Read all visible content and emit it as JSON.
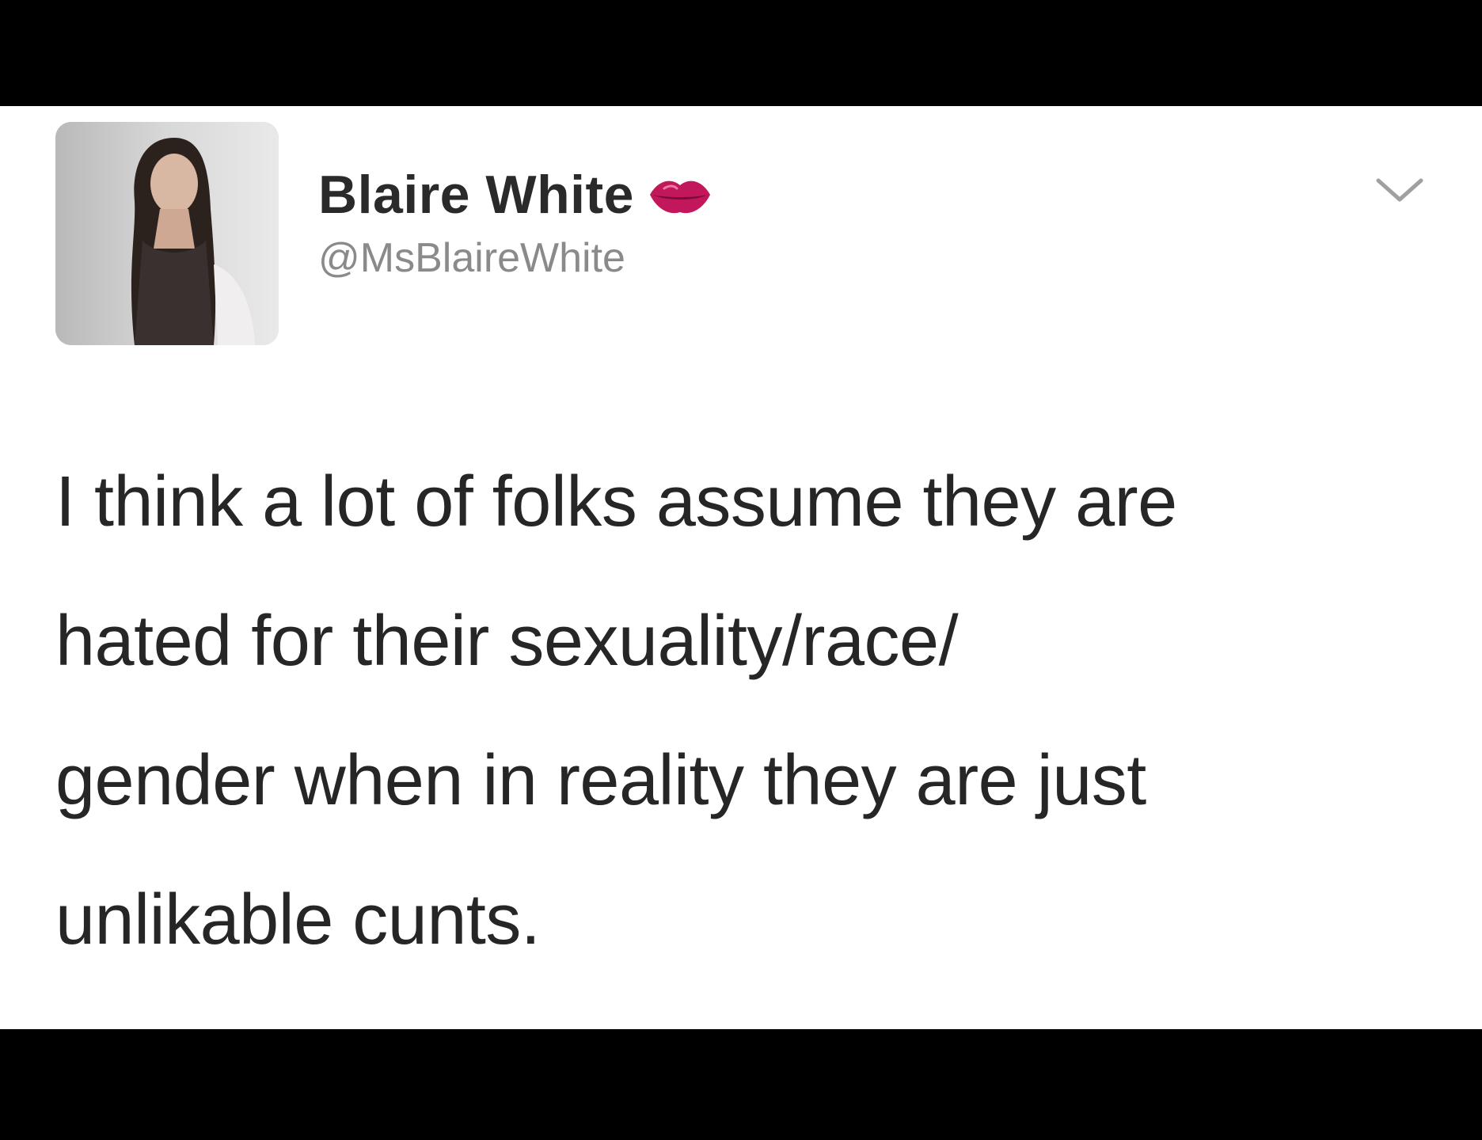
{
  "tweet": {
    "author": {
      "display_name": "Blaire White",
      "handle": "@MsBlaireWhite",
      "verified_badge_icon": "lips-kiss-icon",
      "avatar_icon": "profile-photo"
    },
    "menu_icon": "chevron-down-icon",
    "text_lines": [
      "I think a lot of folks assume they are",
      "hated for their sexuality/race/",
      "gender when in reality they are just",
      "unlikable cunts."
    ]
  },
  "colors": {
    "background": "#ffffff",
    "letterbox": "#000000",
    "name_text": "#2a2a2a",
    "handle_text": "#8a8a8a",
    "body_text": "#262626",
    "badge": "#c2185b",
    "chevron": "#a0a0a0"
  }
}
